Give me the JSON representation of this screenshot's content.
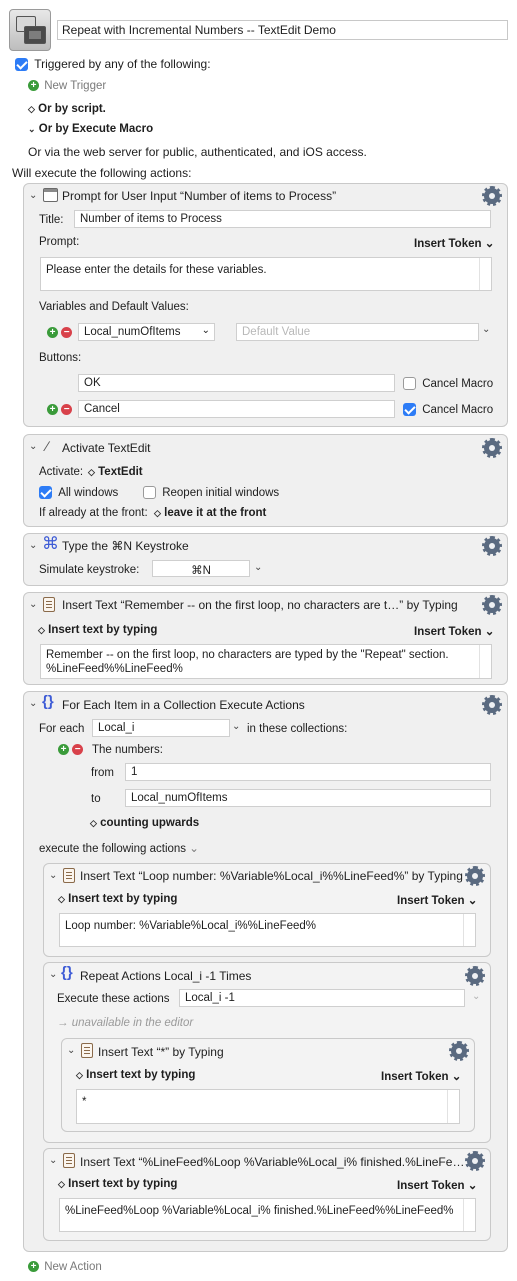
{
  "macro": {
    "title": "Repeat with Incremental Numbers -- TextEdit Demo",
    "triggered_label": "Triggered by any of the following:",
    "new_trigger": "New Trigger",
    "or_by_script": "Or by script.",
    "or_by_execute_macro": "Or by Execute Macro",
    "web_server_note": "Or via the web server for public, authenticated, and iOS access.",
    "will_execute": "Will execute the following actions:",
    "new_action": "New Action"
  },
  "prompt": {
    "header": "Prompt for User Input “Number of items to Process”",
    "title_label": "Title:",
    "title_value": "Number of items to Process",
    "prompt_label": "Prompt:",
    "insert_token": "Insert Token",
    "prompt_text": "Please enter the details for these variables.",
    "vars_label": "Variables and Default Values:",
    "var_name": "Local_numOfItems",
    "default_placeholder": "Default Value",
    "buttons_label": "Buttons:",
    "button1": "OK",
    "button2": "Cancel",
    "cancel_macro": "Cancel Macro"
  },
  "activate": {
    "header": "Activate TextEdit",
    "activate_label": "Activate:",
    "app": "TextEdit",
    "all_windows": "All windows",
    "reopen": "Reopen initial windows",
    "front_label": "If already at the front:",
    "front_value": "leave it at the front"
  },
  "keystroke": {
    "header": "Type the ⌘N Keystroke",
    "simulate_label": "Simulate keystroke:",
    "value": "⌘N"
  },
  "insert1": {
    "header": "Insert Text “Remember -- on the first loop, no characters are t…” by Typing",
    "mode": "Insert text by typing",
    "insert_token": "Insert Token",
    "line1": "Remember -- on the first loop, no characters are typed by the \"Repeat\" section.",
    "line2": "%LineFeed%%LineFeed%"
  },
  "foreach": {
    "header": "For Each Item in a Collection Execute Actions",
    "for_each_label": "For each",
    "var": "Local_i",
    "in_collections": "in these collections:",
    "numbers_label": "The numbers:",
    "from_label": "from",
    "from_value": "1",
    "to_label": "to",
    "to_value": "Local_numOfItems",
    "counting": "counting upwards",
    "execute_label": "execute the following actions"
  },
  "insert2": {
    "header": "Insert Text “Loop number: %Variable%Local_i%%LineFeed%” by Typing",
    "mode": "Insert text by typing",
    "insert_token": "Insert Token",
    "text": "Loop number: %Variable%Local_i%%LineFeed%"
  },
  "repeat": {
    "header": "Repeat Actions Local_i -1  Times",
    "execute_label": "Execute these actions",
    "value": "Local_i -1",
    "unavailable": "unavailable in the editor"
  },
  "insert3": {
    "header": "Insert Text “*” by Typing",
    "mode": "Insert text by typing",
    "insert_token": "Insert Token",
    "text": "*"
  },
  "insert4": {
    "header": "Insert Text “%LineFeed%Loop %Variable%Local_i% finished.%LineFe……",
    "mode": "Insert text by typing",
    "insert_token": "Insert Token",
    "text": "%LineFeed%Loop %Variable%Local_i% finished.%LineFeed%%LineFeed%"
  }
}
